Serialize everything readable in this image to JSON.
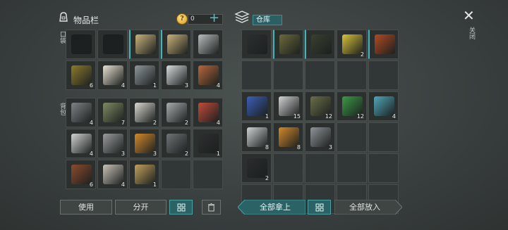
{
  "inventory": {
    "title": "物品栏",
    "coins": "0",
    "plus_label": "+",
    "quick_label": "口袋",
    "bag_label": "背包",
    "quick_slots": [
      {
        "icon": "pistol-icon",
        "color": "#1c1f20"
      },
      {
        "icon": "pistol-icon",
        "color": "#1c1f20"
      },
      {
        "icon": "rifle-icon",
        "color": "#c8b27a"
      },
      {
        "icon": "rifle-icon",
        "color": "#c8b27a"
      },
      {
        "icon": "katana-icon",
        "color": "#b9bcbc"
      },
      {
        "icon": "molotov-icon",
        "color": "#8d7b2a",
        "count": "6"
      },
      {
        "icon": "medicine-icon",
        "color": "#e9e1d1",
        "count": "4"
      },
      {
        "icon": "iron-ingot-icon",
        "color": "#8f979b",
        "count": "1"
      },
      {
        "icon": "steel-plate-icon",
        "color": "#d7dbdc",
        "count": "3"
      },
      {
        "icon": "copper-ingot-icon",
        "color": "#b5683a",
        "count": "4"
      }
    ],
    "bag_slots": [
      {
        "icon": "nails-icon",
        "color": "#7d8387",
        "count": "4"
      },
      {
        "icon": "cloth-icon",
        "color": "#7f8a63",
        "count": "7"
      },
      {
        "icon": "paper-icon",
        "color": "#d8d6cf",
        "count": "2"
      },
      {
        "icon": "engine-part-icon",
        "color": "#a8acae",
        "count": "2"
      },
      {
        "icon": "gas-can-icon",
        "color": "#c24a3a",
        "count": "4"
      },
      {
        "icon": "tape-icon",
        "color": "#d1d3d3",
        "count": "4"
      },
      {
        "icon": "gears-icon",
        "color": "#9a9c9d",
        "count": "3"
      },
      {
        "icon": "battery-icon",
        "color": "#d28a2a",
        "count": "3"
      },
      {
        "icon": "camera-icon",
        "color": "#6f7376",
        "count": "2"
      },
      {
        "icon": "gunpowder-icon",
        "color": "#2e2f30",
        "count": "1"
      },
      {
        "icon": "wire-spool-icon",
        "color": "#8c4b2d",
        "count": "6"
      },
      {
        "icon": "motor-icon",
        "color": "#c9c3b8",
        "count": "4"
      },
      {
        "icon": "circuit-icon",
        "color": "#c2a15a",
        "count": "1"
      },
      {
        "icon": "empty"
      },
      {
        "icon": "empty"
      }
    ]
  },
  "warehouse": {
    "title": "仓库",
    "slots": [
      {
        "icon": "backpack-icon",
        "color": "#2c2f31"
      },
      {
        "icon": "sniper-rifle-icon",
        "color": "#6b6a3c"
      },
      {
        "icon": "sniper-rifle-icon",
        "color": "#3a4030"
      },
      {
        "icon": "battery-pack-icon",
        "color": "#d7c23a",
        "count": "2"
      },
      {
        "icon": "flashlight-icon",
        "color": "#b24a22"
      },
      {
        "icon": "empty"
      },
      {
        "icon": "empty"
      },
      {
        "icon": "empty"
      },
      {
        "icon": "empty"
      },
      {
        "icon": "empty"
      },
      {
        "icon": "circuit-board-icon",
        "color": "#3b5fb8",
        "count": "1"
      },
      {
        "icon": "tape-icon",
        "color": "#d1d3d3",
        "count": "15"
      },
      {
        "icon": "medkit-bag-icon",
        "color": "#6a6f4a",
        "count": "12"
      },
      {
        "icon": "pills-icon",
        "color": "#3c9a46",
        "count": "12"
      },
      {
        "icon": "cable-icon",
        "color": "#4fa7b8",
        "count": "4"
      },
      {
        "icon": "transistor-icon",
        "color": "#cfd2d2",
        "count": "8"
      },
      {
        "icon": "battery-icon",
        "color": "#d28a2a",
        "count": "8"
      },
      {
        "icon": "tools-icon",
        "color": "#8e9499",
        "count": "3"
      },
      {
        "icon": "empty"
      },
      {
        "icon": "empty"
      },
      {
        "icon": "wire-icon",
        "color": "#2a2c2d",
        "count": "2"
      },
      {
        "icon": "empty"
      },
      {
        "icon": "empty"
      },
      {
        "icon": "empty"
      },
      {
        "icon": "empty"
      },
      {
        "icon": "empty"
      },
      {
        "icon": "empty"
      },
      {
        "icon": "empty"
      },
      {
        "icon": "empty"
      },
      {
        "icon": "empty"
      }
    ]
  },
  "buttons": {
    "use": "使用",
    "split": "分开",
    "take_all": "全部拿上",
    "put_all": "全部放入"
  },
  "close": {
    "label": "关闭"
  }
}
